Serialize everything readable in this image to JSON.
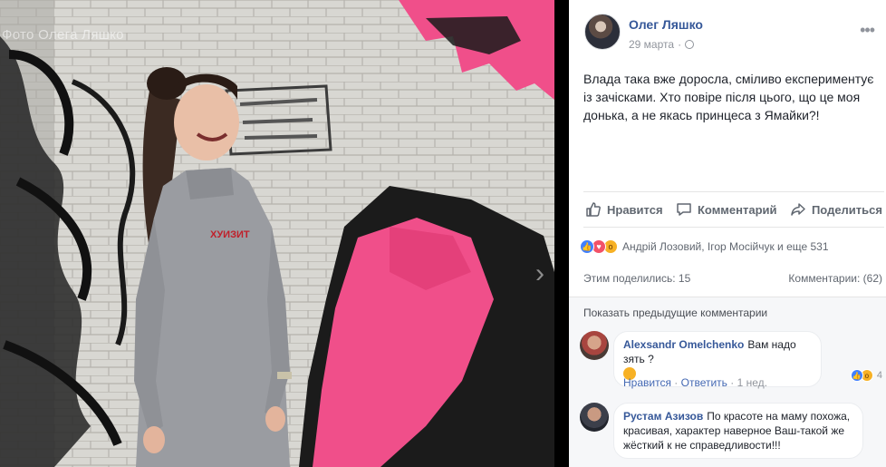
{
  "photo": {
    "watermark": "Фото Олега Ляшко",
    "next_arrow": "›",
    "shirt_text": "ХУИЗИТ"
  },
  "post": {
    "author": "Олег Ляшко",
    "date": "29 марта",
    "date_separator": "·",
    "menu": "•••",
    "text": "Влада така вже доросла, сміливо експериментує із зачісками. Хто повіре після цього, що це моя донька, а не якась принцеса з Ямайки?!"
  },
  "actions": {
    "like": "Нравится",
    "comment": "Комментарий",
    "share": "Поделиться"
  },
  "reactions": {
    "names": "Андрій Лозовий, Ігор Мосійчук и еще 531",
    "icons": [
      "like-icon",
      "love-icon",
      "wow-icon"
    ]
  },
  "stats": {
    "shares": "Этим поделились: 15",
    "comments": "Комментарии: (62)"
  },
  "comments": {
    "show_previous": "Показать предыдущие комментарии",
    "items": [
      {
        "name": "Alexsandr Omelchenko",
        "text": "Вам надо зять ?",
        "like_label": "Нравится",
        "reply_label": "Ответить",
        "time": "1 нед.",
        "reaction_count": "4",
        "separator": "·"
      },
      {
        "name": "Рустам Азизов",
        "text": "По красоте на маму похожа, красивая, характер наверное Ваш-такой же жёсткий к не справедливости!!!"
      }
    ]
  },
  "colors": {
    "link_blue": "#365899",
    "meta_grey": "#90949c",
    "graffiti_pink": "#f04f8a"
  }
}
